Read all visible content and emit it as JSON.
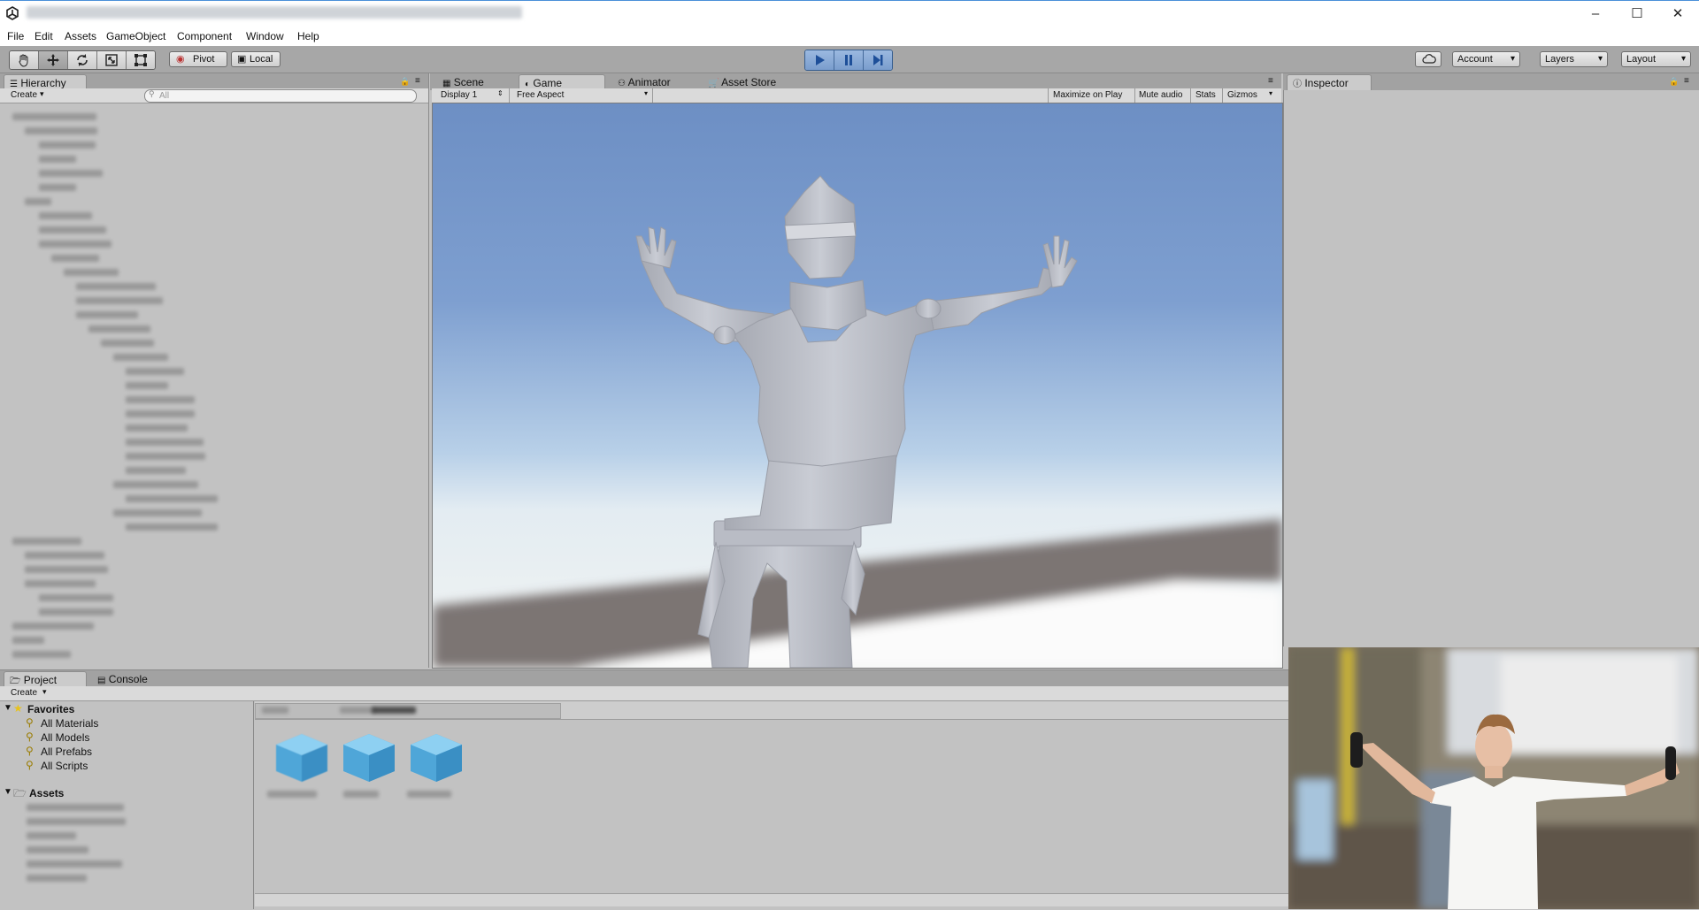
{
  "menu": [
    "File",
    "Edit",
    "Assets",
    "GameObject",
    "Component",
    "Window",
    "Help"
  ],
  "toolbar": {
    "pivot": "Pivot",
    "local": "Local",
    "account": "Account",
    "layers": "Layers",
    "layout": "Layout"
  },
  "hierarchy": {
    "tab": "Hierarchy",
    "create": "Create",
    "search_placeholder": "All"
  },
  "center_tabs": [
    "Scene",
    "Game",
    "Animator",
    "Asset Store"
  ],
  "game_bar": {
    "display": "Display 1",
    "aspect": "Free Aspect",
    "maximize": "Maximize on Play",
    "mute": "Mute audio",
    "stats": "Stats",
    "gizmos": "Gizmos"
  },
  "inspector": {
    "tab": "Inspector"
  },
  "bottom_tabs": [
    "Project",
    "Console"
  ],
  "project": {
    "create": "Create",
    "favorites_label": "Favorites",
    "favorites": [
      "All Materials",
      "All Models",
      "All Prefabs",
      "All Scripts"
    ],
    "assets_label": "Assets"
  },
  "colors": {
    "editor_bg": "#c2c2c2",
    "play_accent": "#4b87d6",
    "sky_top": "#6e90c5",
    "ground": "#7d7676"
  }
}
